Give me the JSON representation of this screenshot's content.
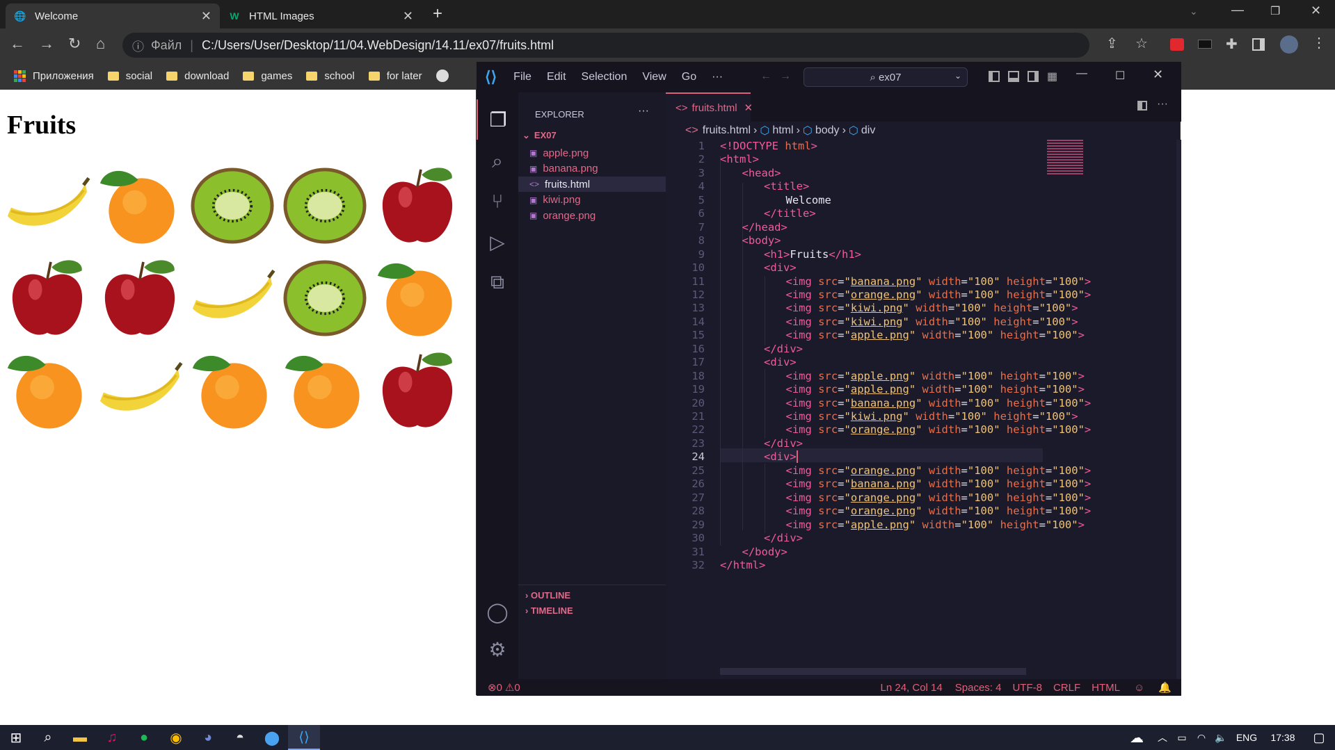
{
  "browser": {
    "tabs": [
      {
        "title": "Welcome",
        "favicon": "globe-icon"
      },
      {
        "title": "HTML Images",
        "favicon": "w3schools-icon"
      }
    ],
    "file_label": "Файл",
    "url": "C:/Users/User/Desktop/11/04.WebDesign/14.11/ex07/fruits.html",
    "bookmarks": [
      {
        "label": "Приложения",
        "icon": "apps-icon"
      },
      {
        "label": "social"
      },
      {
        "label": "download"
      },
      {
        "label": "games"
      },
      {
        "label": "school"
      },
      {
        "label": "for later"
      }
    ]
  },
  "page": {
    "heading": "Fruits",
    "rows": [
      [
        "banana",
        "orange",
        "kiwi",
        "kiwi",
        "apple"
      ],
      [
        "apple",
        "apple",
        "banana",
        "kiwi",
        "orange"
      ],
      [
        "orange",
        "banana",
        "orange",
        "orange",
        "apple"
      ]
    ]
  },
  "vscode": {
    "menu": [
      "File",
      "Edit",
      "Selection",
      "View",
      "Go"
    ],
    "more": "···",
    "search": "ex07",
    "explorer_title": "EXPLORER",
    "folder": "EX07",
    "files": [
      "apple.png",
      "banana.png",
      "fruits.html",
      "kiwi.png",
      "orange.png"
    ],
    "active_file": "fruits.html",
    "outline": "OUTLINE",
    "timeline": "TIMELINE",
    "tab": "fruits.html",
    "breadcrumbs": [
      "fruits.html",
      "html",
      "body",
      "div"
    ],
    "current_line": "24",
    "status": {
      "errors": "0",
      "warnings": "0",
      "position": "Ln 24, Col 14",
      "spaces": "Spaces: 4",
      "encoding": "UTF-8",
      "eol": "CRLF",
      "language": "HTML"
    }
  },
  "taskbar": {
    "language": "ENG",
    "time": "17:38"
  },
  "colors": {
    "tag": "#f25b9a",
    "attr": "#e86f4a",
    "string": "#f0c374",
    "editor_bg": "#1b1a2b"
  }
}
